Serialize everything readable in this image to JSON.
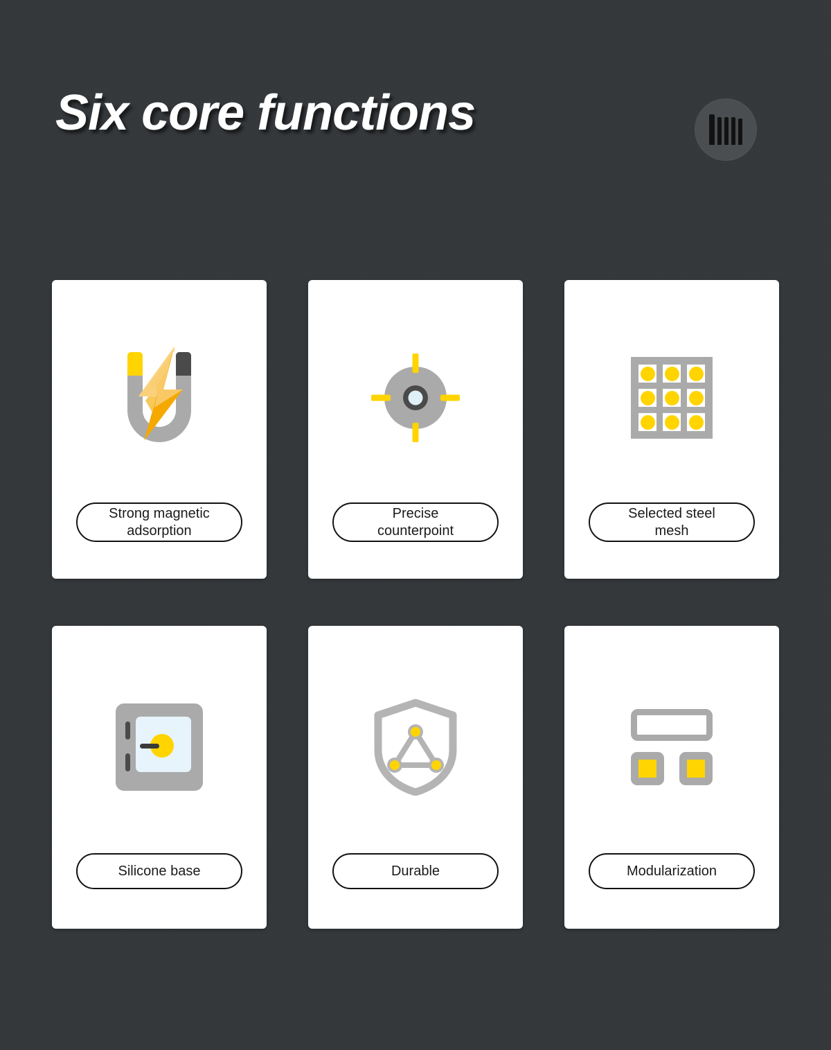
{
  "header": {
    "title": "Six core functions",
    "logo": {
      "name": "barcode-logo",
      "bar_count": 5,
      "circle_color": "#4b4e51",
      "bar_color": "#121212"
    }
  },
  "theme": {
    "background": "#34373a",
    "card_background": "#ffffff",
    "accent_yellow": "#ffd400",
    "accent_orange": "#f5a800",
    "grey": "#aaaaaa",
    "dark_grey": "#4a4a4a",
    "label_border": "#111111",
    "panel_blue": "#e7f4fb"
  },
  "cards": [
    {
      "id": "strong-magnetic-adsorption",
      "icon": "magnet-bolt-icon",
      "label_lines": [
        "Strong magnetic",
        "adsorption"
      ],
      "label": "Strong magnetic adsorption"
    },
    {
      "id": "precise-counterpoint",
      "icon": "crosshair-target-icon",
      "label_lines": [
        "Precise",
        "counterpoint"
      ],
      "label": "Precise counterpoint"
    },
    {
      "id": "selected-steel-mesh",
      "icon": "steel-mesh-grid-icon",
      "label_lines": [
        "Selected steel",
        "mesh"
      ],
      "label": "Selected steel mesh"
    },
    {
      "id": "silicone-base",
      "icon": "safe-box-icon",
      "label_lines": [
        "Silicone base"
      ],
      "label": "Silicone base"
    },
    {
      "id": "durable",
      "icon": "shield-network-icon",
      "label_lines": [
        "Durable"
      ],
      "label": "Durable"
    },
    {
      "id": "modularization",
      "icon": "modules-blocks-icon",
      "label_lines": [
        "Modularization"
      ],
      "label": "Modularization"
    }
  ]
}
